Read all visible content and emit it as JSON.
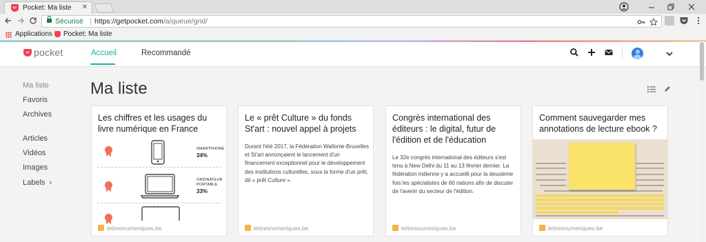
{
  "browser": {
    "tab_title": "Pocket: Ma liste",
    "tab_close": "✕",
    "secure_label": "Sécurisé",
    "url_host": "https://getpocket.com",
    "url_path": "/a/queue/grid/",
    "bookmarks": {
      "apps_label": "Applications",
      "pocket_label": "Pocket: Ma liste"
    },
    "icons": [
      "back-icon",
      "forward-icon",
      "reload-icon",
      "key-icon",
      "star-icon",
      "extension-icon",
      "pocket-extension-icon",
      "menu-icon"
    ]
  },
  "header": {
    "logo_text": "pocket",
    "nav": {
      "home": "Accueil",
      "recommended": "Recommandé"
    },
    "icons": [
      "search-icon",
      "add-icon",
      "inbox-icon",
      "avatar",
      "chevron-down-icon"
    ]
  },
  "sidebar": {
    "my_list": "Ma liste",
    "favorites": "Favoris",
    "archives": "Archives",
    "articles": "Articles",
    "videos": "Vidéos",
    "images": "Images",
    "labels": "Labels",
    "labels_chevron": "›"
  },
  "main": {
    "title": "Ma liste",
    "cards": [
      {
        "title": "Les chiffres et les usages du livre numérique en France",
        "source": "lettresnumeriques.be",
        "image": {
          "rows": [
            {
              "label": "SMARTPHONE",
              "value": "34%"
            },
            {
              "label": "ORDINATEUR PORTABLE",
              "value": "33%"
            }
          ]
        }
      },
      {
        "title": "Le « prêt Culture » du fonds St'art : nouvel appel à projets",
        "excerpt": "Durant l'été 2017, la Fédération Wallonie-Bruxelles et St'art annonçaient le lancement d'un financement exceptionnel pour le développement des institutions culturelles, sous la forme d'un prêt, dit « prêt Culture ».",
        "source": "lettresnumeriques.be"
      },
      {
        "title": "Congrès international des éditeurs : le digital, futur de l'édition et de l'éducation",
        "excerpt": "Le 32e congrès international des éditeurs s'est tenu à New Delhi du 11 au 13 février dernier. La fédération indienne y a accueilli pour la deuxième fois les spécialistes de 60 nations afin de discuter de l'avenir du secteur de l'édition.",
        "source": "lettresnumeriques.be"
      },
      {
        "title": "Comment sauvegarder mes annotations de lecture ebook ?",
        "source": "lettresnumeriques.be"
      }
    ]
  },
  "colors": {
    "accent": "#1cb0a8",
    "brand": "#ef4056",
    "source_favicon": "#f6b24a"
  }
}
